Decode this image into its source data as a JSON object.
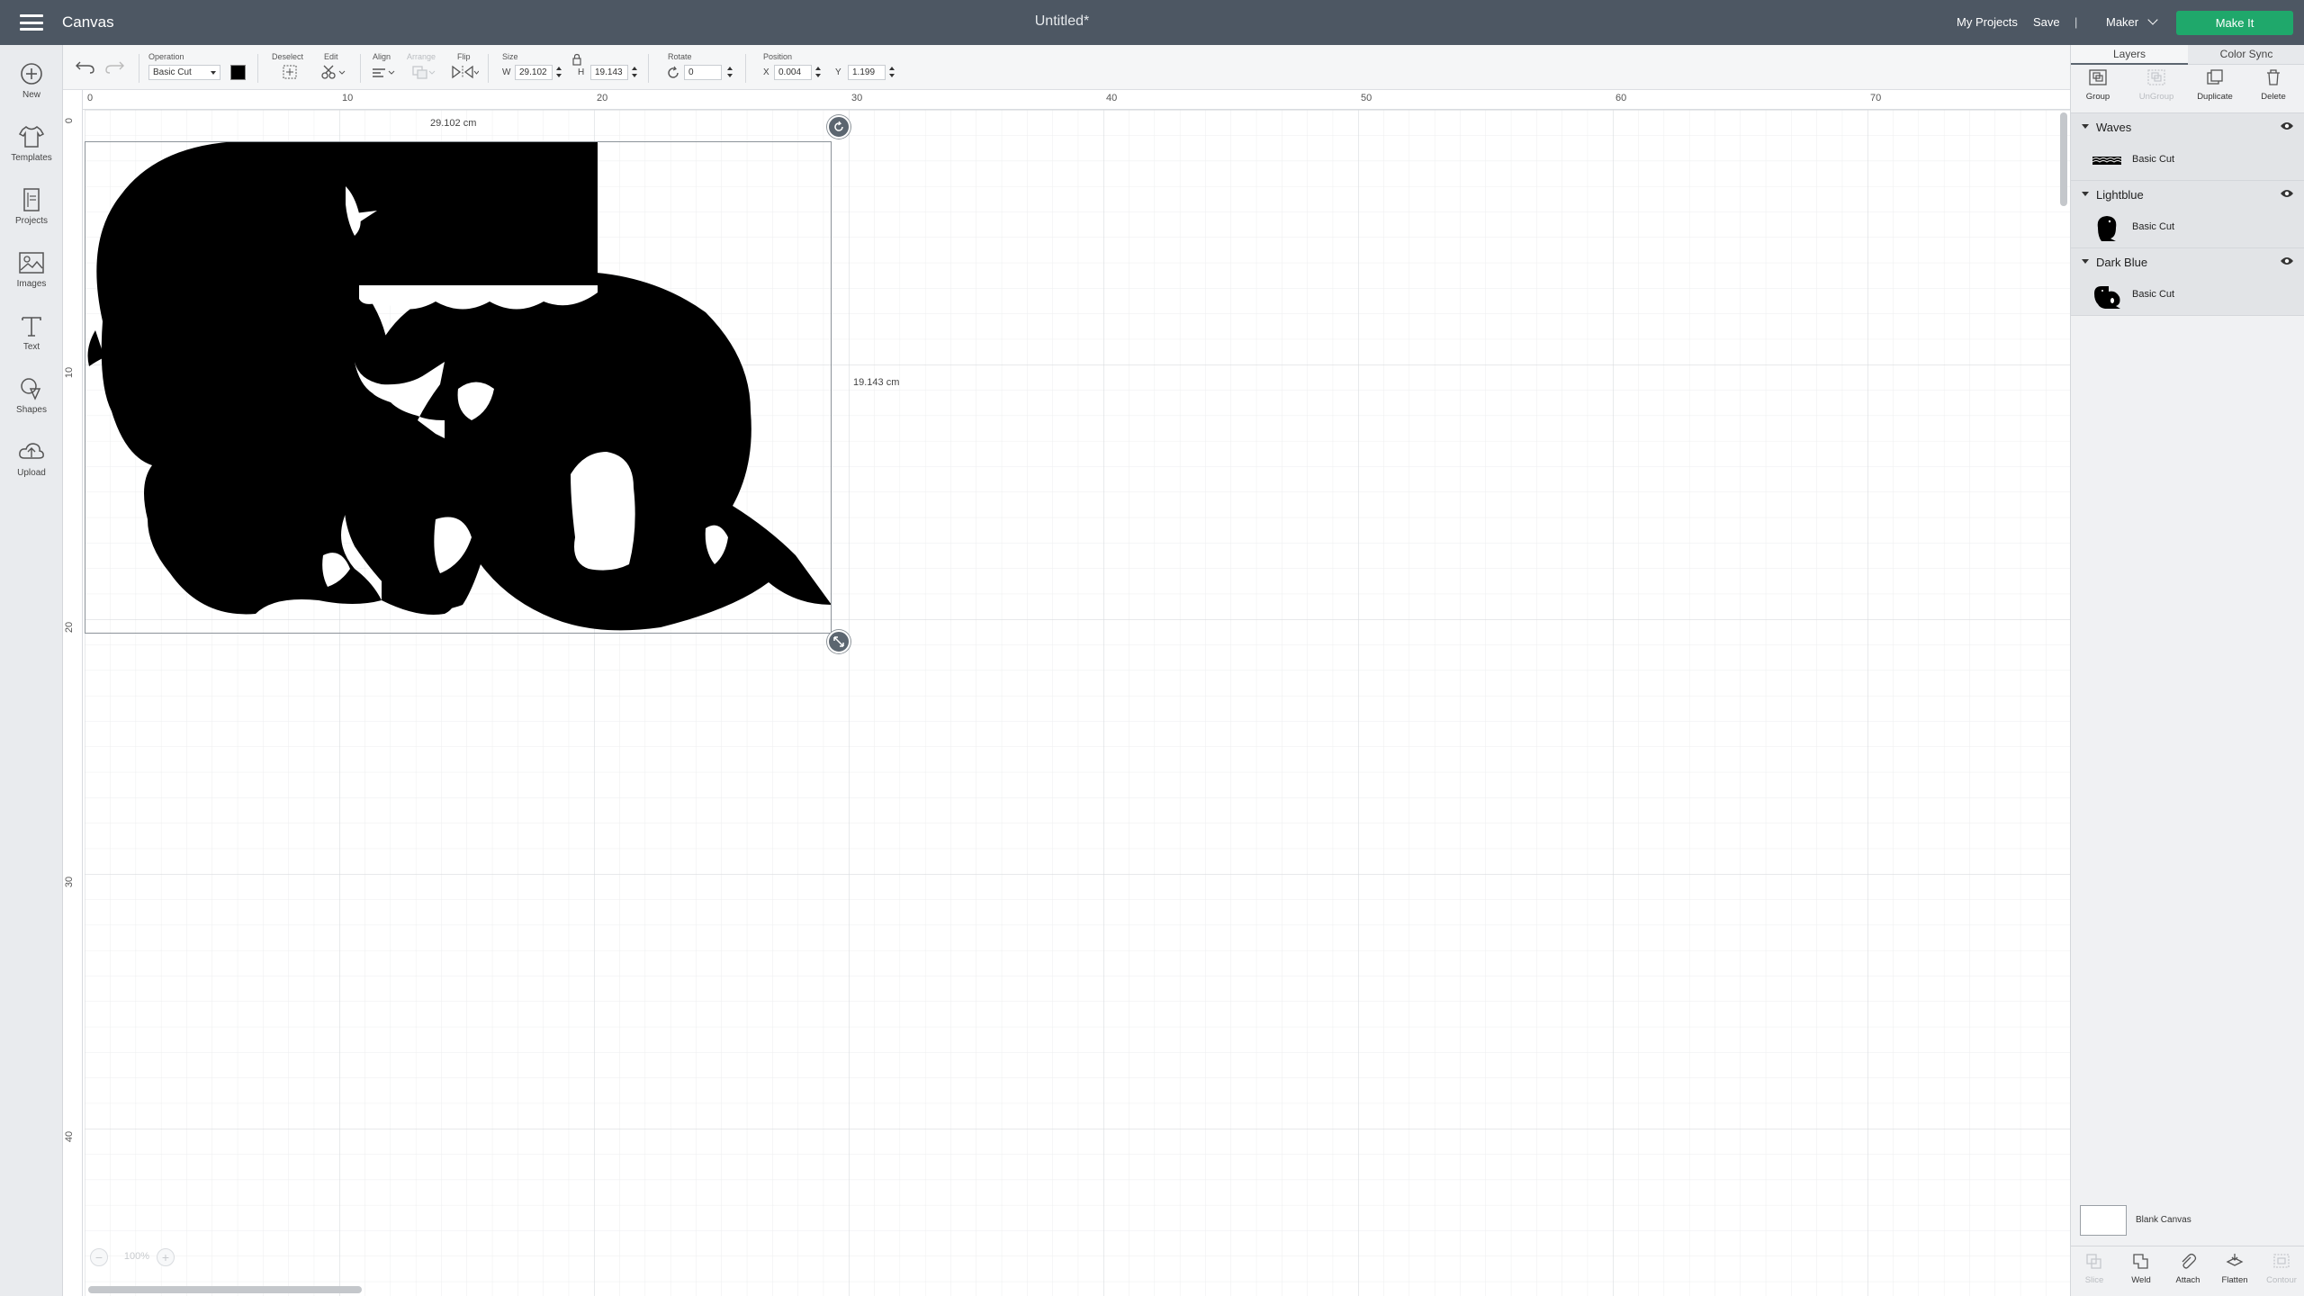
{
  "header": {
    "app_title": "Canvas",
    "doc_title": "Untitled*",
    "my_projects": "My Projects",
    "save": "Save",
    "separator": "|",
    "machine": "Maker",
    "make_it": "Make It"
  },
  "left_tools": [
    {
      "label": "New",
      "icon": "plus-circle-icon"
    },
    {
      "label": "Templates",
      "icon": "shirt-icon"
    },
    {
      "label": "Projects",
      "icon": "projects-icon"
    },
    {
      "label": "Images",
      "icon": "image-icon"
    },
    {
      "label": "Text",
      "icon": "text-icon"
    },
    {
      "label": "Shapes",
      "icon": "shapes-icon"
    },
    {
      "label": "Upload",
      "icon": "cloud-upload-icon"
    }
  ],
  "toolbar": {
    "operation_label": "Operation",
    "operation_value": "Basic Cut",
    "deselect_label": "Deselect",
    "edit_label": "Edit",
    "align_label": "Align",
    "arrange_label": "Arrange",
    "flip_label": "Flip",
    "size_label": "Size",
    "w_label": "W",
    "w_value": "29.102",
    "h_label": "H",
    "h_value": "19.143",
    "rotate_label": "Rotate",
    "rotate_value": "0",
    "position_label": "Position",
    "x_label": "X",
    "x_value": "0.004",
    "y_label": "Y",
    "y_value": "1.199",
    "swatch_color": "#000000"
  },
  "rulers": {
    "top": [
      "0",
      "10",
      "20",
      "30",
      "40",
      "50",
      "60",
      "70"
    ],
    "left": [
      "0",
      "10",
      "20",
      "30",
      "40"
    ]
  },
  "canvas": {
    "width_dimension": "29.102 cm",
    "height_dimension": "19.143 cm",
    "zoom_value": "100%",
    "zoom_out": "−",
    "zoom_in": "+"
  },
  "panel": {
    "tabs": [
      "Layers",
      "Color Sync"
    ],
    "layer_tools": [
      {
        "label": "Group",
        "enabled": true
      },
      {
        "label": "UnGroup",
        "enabled": false
      },
      {
        "label": "Duplicate",
        "enabled": true
      },
      {
        "label": "Delete",
        "enabled": true
      }
    ],
    "layers": [
      {
        "name": "Waves",
        "operation": "Basic Cut"
      },
      {
        "name": "Lightblue",
        "operation": "Basic Cut"
      },
      {
        "name": "Dark Blue",
        "operation": "Basic Cut"
      }
    ],
    "blank_canvas": "Blank Canvas",
    "bottom_tools": [
      {
        "label": "Slice",
        "enabled": false
      },
      {
        "label": "Weld",
        "enabled": true
      },
      {
        "label": "Attach",
        "enabled": true
      },
      {
        "label": "Flatten",
        "enabled": true
      },
      {
        "label": "Contour",
        "enabled": false
      }
    ]
  },
  "colors": {
    "header_bg": "#4d5763",
    "make_it_bg": "#1fa86b",
    "design_fill": "#000000"
  }
}
